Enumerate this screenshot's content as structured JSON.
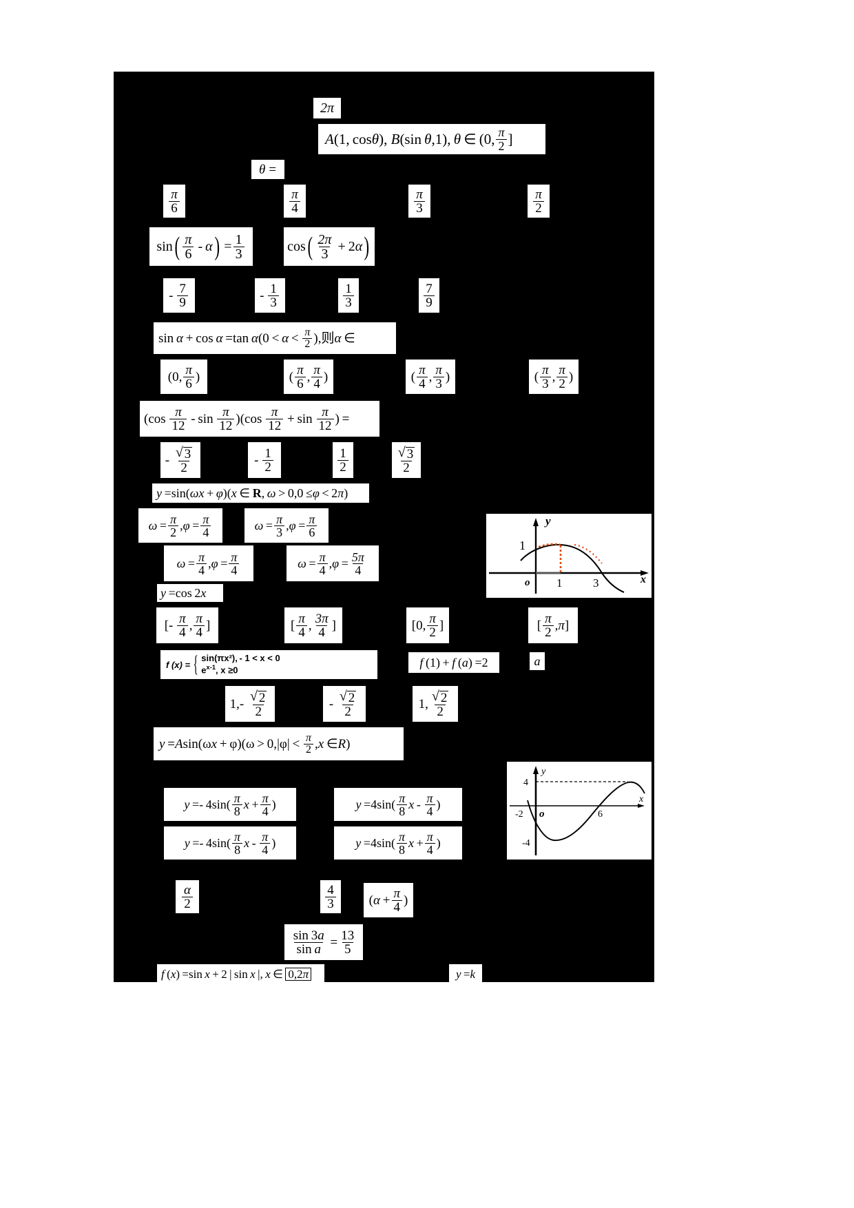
{
  "document": {
    "title": "Trigonometry multiple-choice worksheet (scanned formula fragments on black background)",
    "background_color": "#000000",
    "page_color": "#ffffff",
    "formula_color": "#000000"
  },
  "items": {
    "two_pi": "2π",
    "points_line": "A(1, cos θ), B(sin θ,1), θ ∈ (0,π/2]",
    "theta_eq": "θ =",
    "q1_options": [
      "π/6",
      "π/4",
      "π/3",
      "π/2"
    ],
    "q2_left": "sin(π/6 − α) = 1/3",
    "q2_right": "cos(2π/3 + 2α)",
    "q2_options": [
      "-7/9",
      "-1/3",
      "1/3",
      "7/9"
    ],
    "q3_stem": "sin α + cos α = tan α(0 < α < π/2), 则 α ∈",
    "q3_options": [
      "(0, π/6)",
      "(π/6 , π/4)",
      "(π/4 , π/3)",
      "(π/3 , π/2)"
    ],
    "q4_stem": "(cos π/12 − sin π/12)(cos π/12 + sin π/12) =",
    "q4_options": [
      "-√3/2",
      "-1/2",
      "1/2",
      "√3/2"
    ],
    "q5_stem": "y = sin(ωx + φ)(x ∈ R, ω > 0,0 ≤ φ < 2π)",
    "q5_options": [
      "ω = π/2 , φ = π/4",
      "ω = π/3 , φ = π/6",
      "ω = π/4 , φ = π/4",
      "ω = π/4 , φ = 5π/4"
    ],
    "q6_stem": "y = cos 2x",
    "q6_options": [
      "[-π/4 , π/4]",
      "[π/4 , 3π/4]",
      "[0, π/2]",
      "[π/2 , π]"
    ],
    "q7_piecewise": "f (x) = { sin(πx²), -1 < x < 0 ; e^{x-1}, x ≥ 0",
    "q7_cond": "f (1) + f (a) = 2",
    "q7_var": "a",
    "q7_options": [
      "1, -√2/2",
      "-√2/2",
      "1, √2/2"
    ],
    "q8_stem": "y = A sin(ωx + φ)(ω > 0, |φ| < π/2 , x ∈ R)",
    "q8_options": [
      "y = -4 sin(π/8 x + π/4)",
      "y = 4 sin(π/8 x − π/4)",
      "y = -4 sin(π/8 x − π/4)",
      "y = 4 sin(π/8 x + π/4)"
    ],
    "q9_a": "α/2",
    "q9_b": "4/3",
    "q9_c": "(α + π/4)",
    "q10_stem": "sin 3a / sin a = 13/5",
    "q11_stem": "f (x) = sin x + 2 | sin x |, x ∈ [0,2π]",
    "q11_right": "y = k"
  },
  "graph1": {
    "axis_x_label": "x",
    "axis_y_label": "y",
    "origin_label": "o",
    "y_ticks": [
      "1"
    ],
    "x_ticks": [
      "1",
      "3"
    ],
    "curve": "cosine-like arc peaking near x=1 at y=1, crossing x-axis near x=3",
    "dash_color": "#e04a10"
  },
  "graph2": {
    "axis_x_label": "x",
    "axis_y_label": "y",
    "origin_label": "o",
    "y_ticks": [
      "4",
      "-4"
    ],
    "x_ticks": [
      "-2",
      "6"
    ],
    "curve": "sine-like wave: crosses near x=-2 going down to -4, rising to +4 near x=10",
    "dash_color": "#000000"
  }
}
